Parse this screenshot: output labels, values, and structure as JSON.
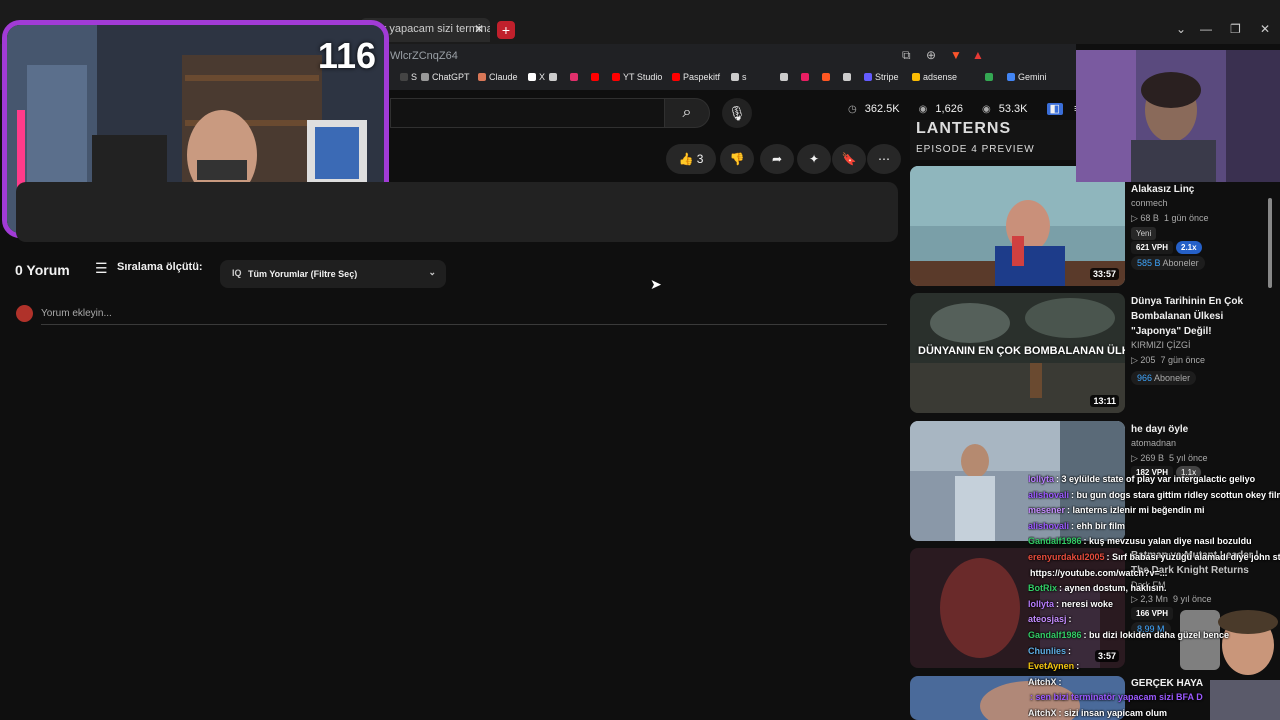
{
  "browser": {
    "tab_title": "ktör yapacam sizi termina",
    "url": "WlcrZCnqZ64",
    "bookmarks": [
      {
        "label": "S",
        "color": "#444"
      },
      {
        "label": "ChatGPT",
        "color": "#999"
      },
      {
        "label": "Claude",
        "color": "#d97757"
      },
      {
        "label": "X",
        "color": "#fff"
      },
      {
        "label": "",
        "color": "#ccc"
      },
      {
        "label": "",
        "color": "#e1306c"
      },
      {
        "label": "",
        "color": "#f00"
      },
      {
        "label": "YT Studio",
        "color": "#f00"
      },
      {
        "label": "Paspekitf",
        "color": "#f00"
      },
      {
        "label": "s",
        "color": "#ccc"
      },
      {
        "label": "",
        "color": "#ccc"
      },
      {
        "label": "",
        "color": "#e91e63"
      },
      {
        "label": "",
        "color": "#ff5722"
      },
      {
        "label": "",
        "color": "#ccc"
      },
      {
        "label": "Stripe",
        "color": "#635bff"
      },
      {
        "label": "adsense",
        "color": "#fbbc04"
      },
      {
        "label": "",
        "color": "#34a853"
      },
      {
        "label": "Gemini",
        "color": "#4285f4"
      }
    ]
  },
  "header": {
    "stats": [
      "362.5K",
      "1,626",
      "53.3K"
    ]
  },
  "actions": {
    "like_count": "3"
  },
  "comments": {
    "count_label": "0 Yorum",
    "sort_label": "Sıralama ölçütü:",
    "filter_label": "Tüm Yorumlar (Filtre Seç)",
    "add_placeholder": "Yorum ekleyin..."
  },
  "sidebar": {
    "top_banner": "LANTERNS",
    "top_banner_sub": "EPISODE 4 PREVIEW",
    "videos": [
      {
        "title": "Alakasız Linç",
        "channel": "conmech",
        "views": "68 B",
        "age": "1 gün önce",
        "badge": "Yeni",
        "vph": "621 VPH",
        "ratio": "2.1x",
        "subs": "585 B",
        "subs_label": "Aboneler",
        "duration": "33:57"
      },
      {
        "title": "Dünya Tarihinin En Çok Bombalanan Ülkesi \"Japonya\" Değil!",
        "channel": "KIRMIZI ÇİZGİ",
        "views": "205",
        "age": "7 gün önce",
        "subs": "966",
        "subs_label": "Aboneler",
        "duration": "13:11",
        "thumb_text": "DÜNYANIN EN ÇOK BOMBALANAN ÜLKESİ"
      },
      {
        "title": "he dayı öyle",
        "channel": "atomadnan",
        "views": "269 B",
        "age": "5 yıl önce",
        "vph": "182 VPH",
        "ratio": "1.1x"
      },
      {
        "title": "Batman ve Mutant Leader | The Dark Knight Returns",
        "channel": "Dark FM",
        "views": "2,3 Mn",
        "age": "9 yıl önce",
        "vph": "166 VPH",
        "subs": "8,99 M",
        "duration": "3:57"
      },
      {
        "title": "GERÇEK HAYA"
      }
    ]
  },
  "stream": {
    "cam_number": "116"
  },
  "chat": [
    {
      "user": "lollyta",
      "color": "#b77cff",
      "text": ": 3 eylülde state of play var intergalactic geliyo"
    },
    {
      "user": "alishovali",
      "color": "#9b59ff",
      "text": ": bu gun dogs stara gittim ridley scottun okey film"
    },
    {
      "user": "mesener",
      "color": "#c58cff",
      "text": ": lanterns izlenir mi beğendin mi"
    },
    {
      "user": "alishovali",
      "color": "#9b59ff",
      "text": ": ehh bir film"
    },
    {
      "user": "Gandalf1986",
      "color": "#33cc66",
      "text": ": kuş mevzusu yalan diye nasıl bozuldu"
    },
    {
      "user": "erenyurdakul2005",
      "color": "#e74c3c",
      "text": ": Sırf babası yüzüğü alamadı diye john stewart"
    },
    {
      "user": "",
      "color": "#fff",
      "text": "https://youtube.com/watch?v=..."
    },
    {
      "user": "BotRix",
      "color": "#33cc66",
      "text": ": aynen dostum, haklısın."
    },
    {
      "user": "lollyta",
      "color": "#b77cff",
      "text": ": neresi woke"
    },
    {
      "user": "ateosjasj",
      "color": "#c58cff",
      "text": ":"
    },
    {
      "user": "Gandalf1986",
      "color": "#33cc66",
      "text": ": bu dizi lokiden daha güzel bence"
    },
    {
      "user": "Chunlies",
      "color": "#5dade2",
      "text": ":"
    },
    {
      "user": "EvetAynen",
      "color": "#f1c40f",
      "text": ":"
    },
    {
      "user": "AitchX",
      "color": "#f1f1f1",
      "text": ":"
    },
    {
      "user": "",
      "color": "#9b59ff",
      "text": ": sen bizi terminatör yapacam sizi BFA D"
    },
    {
      "user": "AitchX",
      "color": "#f1f1f1",
      "text": ": sizi insan yapicam olum"
    }
  ]
}
